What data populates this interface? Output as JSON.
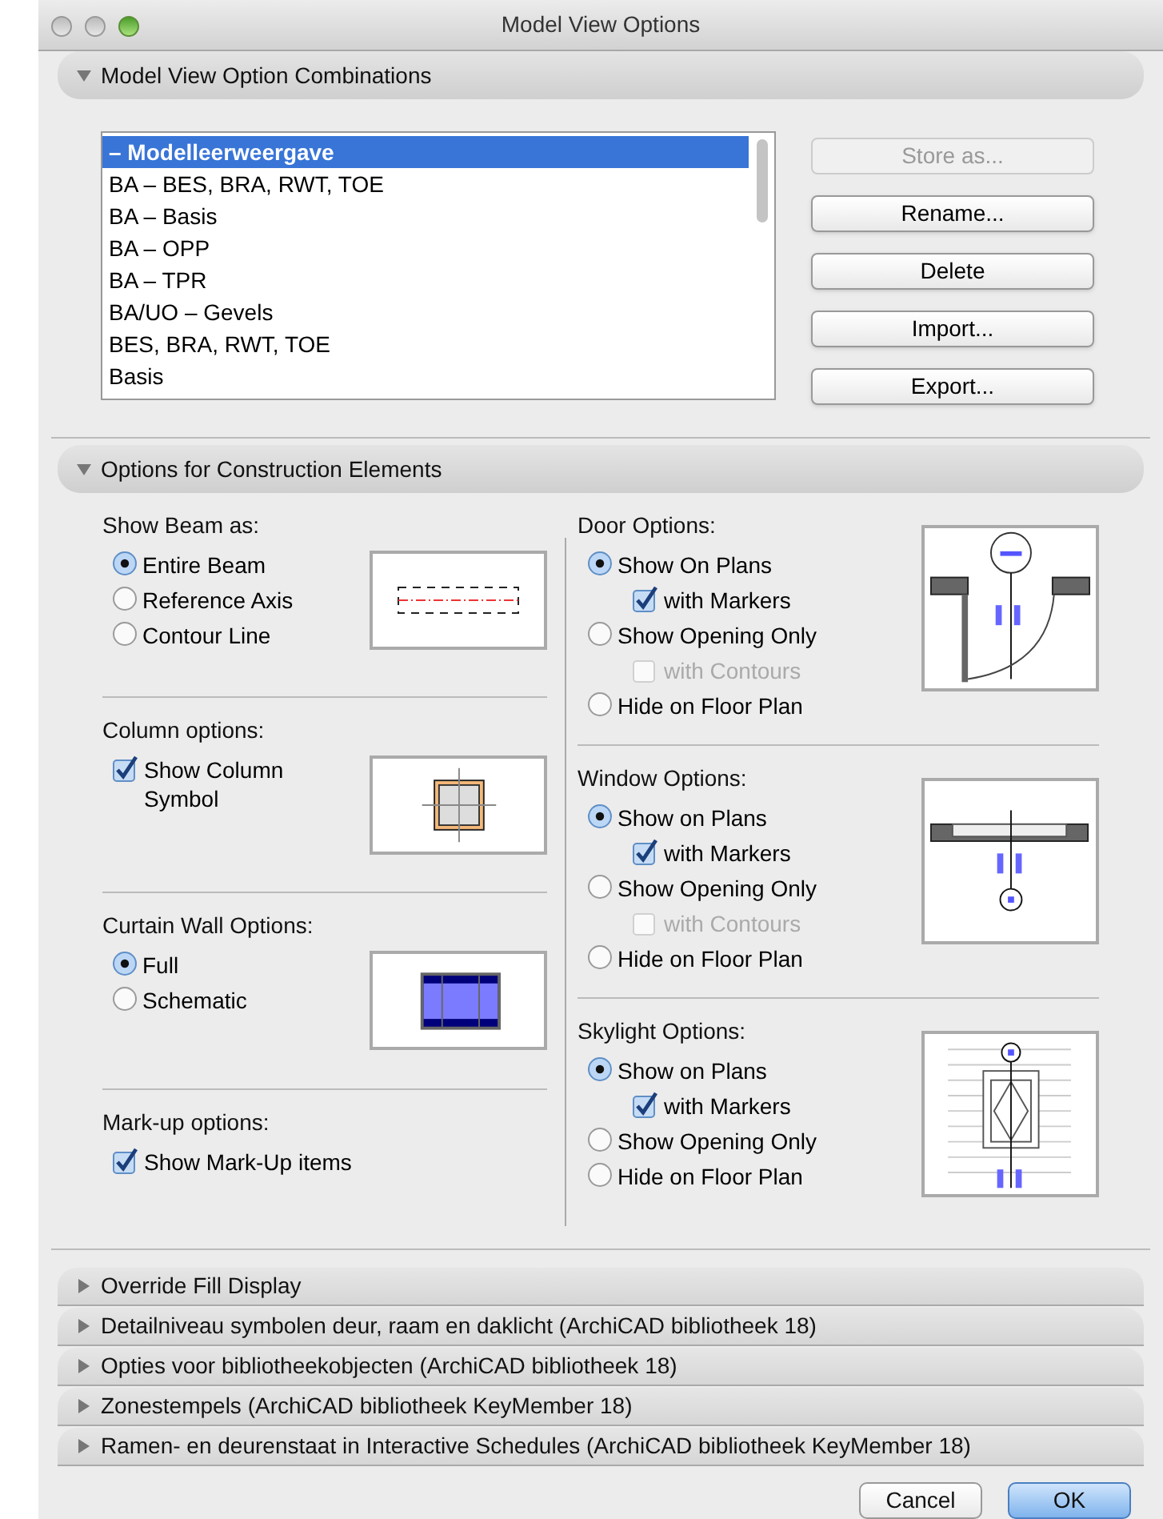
{
  "window": {
    "title": "Model View Options"
  },
  "combinations": {
    "header": {
      "title": "Model View Option Combinations",
      "expanded": true
    },
    "list": [
      {
        "label": "– Modelleerweergave",
        "selected": true
      },
      {
        "label": "BA – BES, BRA, RWT, TOE",
        "selected": false
      },
      {
        "label": "BA – Basis",
        "selected": false
      },
      {
        "label": "BA – OPP",
        "selected": false
      },
      {
        "label": "BA – TPR",
        "selected": false
      },
      {
        "label": "BA/UO – Gevels",
        "selected": false
      },
      {
        "label": "BES, BRA, RWT, TOE",
        "selected": false
      },
      {
        "label": "Basis",
        "selected": false
      }
    ],
    "buttons": [
      {
        "label": "Store as...",
        "disabled": true
      },
      {
        "label": "Rename...",
        "disabled": false
      },
      {
        "label": "Delete",
        "disabled": false
      },
      {
        "label": "Import...",
        "disabled": false
      },
      {
        "label": "Export...",
        "disabled": false
      }
    ]
  },
  "construction": {
    "header": {
      "title": "Options for Construction Elements",
      "expanded": true
    },
    "left_groups": [
      {
        "title": "Show Beam as:",
        "kind": "beam",
        "options": [
          {
            "kind": "radio",
            "label": "Entire Beam",
            "selected": true,
            "disabled": false
          },
          {
            "kind": "radio",
            "label": "Reference Axis",
            "selected": false,
            "disabled": false
          },
          {
            "kind": "radio",
            "label": "Contour Line",
            "selected": false,
            "disabled": false
          }
        ]
      },
      {
        "title": "Column options:",
        "kind": "column",
        "options": [
          {
            "kind": "checkbox",
            "label": "Show Column Symbol",
            "checked": true,
            "disabled": false
          }
        ]
      },
      {
        "title": "Curtain Wall Options:",
        "kind": "curtain",
        "options": [
          {
            "kind": "radio",
            "label": "Full",
            "selected": true,
            "disabled": false
          },
          {
            "kind": "radio",
            "label": "Schematic",
            "selected": false,
            "disabled": false
          }
        ]
      },
      {
        "title": "Mark-up options:",
        "kind": "markup",
        "options": [
          {
            "kind": "checkbox",
            "label": "Show Mark-Up items",
            "checked": true,
            "disabled": false
          }
        ]
      }
    ],
    "right_groups": [
      {
        "title": "Door Options:",
        "kind": "door",
        "options": [
          {
            "kind": "radio",
            "label": "Show On Plans",
            "selected": true,
            "disabled": false,
            "children": [
              {
                "kind": "checkbox",
                "label": "with Markers",
                "checked": true,
                "disabled": false
              }
            ]
          },
          {
            "kind": "radio",
            "label": "Show Opening Only",
            "selected": false,
            "disabled": false,
            "children": [
              {
                "kind": "checkbox",
                "label": "with Contours",
                "checked": false,
                "disabled": true
              }
            ]
          },
          {
            "kind": "radio",
            "label": "Hide on Floor Plan",
            "selected": false,
            "disabled": false
          }
        ]
      },
      {
        "title": "Window Options:",
        "kind": "window",
        "options": [
          {
            "kind": "radio",
            "label": "Show on Plans",
            "selected": true,
            "disabled": false,
            "children": [
              {
                "kind": "checkbox",
                "label": "with Markers",
                "checked": true,
                "disabled": false
              }
            ]
          },
          {
            "kind": "radio",
            "label": "Show Opening Only",
            "selected": false,
            "disabled": false,
            "children": [
              {
                "kind": "checkbox",
                "label": "with Contours",
                "checked": false,
                "disabled": true
              }
            ]
          },
          {
            "kind": "radio",
            "label": "Hide on Floor Plan",
            "selected": false,
            "disabled": false
          }
        ]
      },
      {
        "title": "Skylight Options:",
        "kind": "skylight",
        "options": [
          {
            "kind": "radio",
            "label": "Show on Plans",
            "selected": true,
            "disabled": false,
            "children": [
              {
                "kind": "checkbox",
                "label": "with Markers",
                "checked": true,
                "disabled": false
              }
            ]
          },
          {
            "kind": "radio",
            "label": "Show Opening Only",
            "selected": false,
            "disabled": false
          },
          {
            "kind": "radio",
            "label": "Hide on Floor Plan",
            "selected": false,
            "disabled": false
          }
        ]
      }
    ]
  },
  "collapsed_panels": [
    {
      "title": "Override Fill Display",
      "expanded": false
    },
    {
      "title": "Detailniveau symbolen deur, raam en daklicht (ArchiCAD bibliotheek 18)",
      "expanded": false
    },
    {
      "title": "Opties voor bibliotheekobjecten (ArchiCAD bibliotheek 18)",
      "expanded": false
    },
    {
      "title": "Zonestempels (ArchiCAD bibliotheek KeyMember 18)",
      "expanded": false
    },
    {
      "title": "Ramen- en deurenstaat in Interactive Schedules (ArchiCAD bibliotheek KeyMember 18)",
      "expanded": false
    }
  ],
  "footer_buttons": [
    {
      "label": "Cancel",
      "default": false
    },
    {
      "label": "OK",
      "default": true
    }
  ]
}
